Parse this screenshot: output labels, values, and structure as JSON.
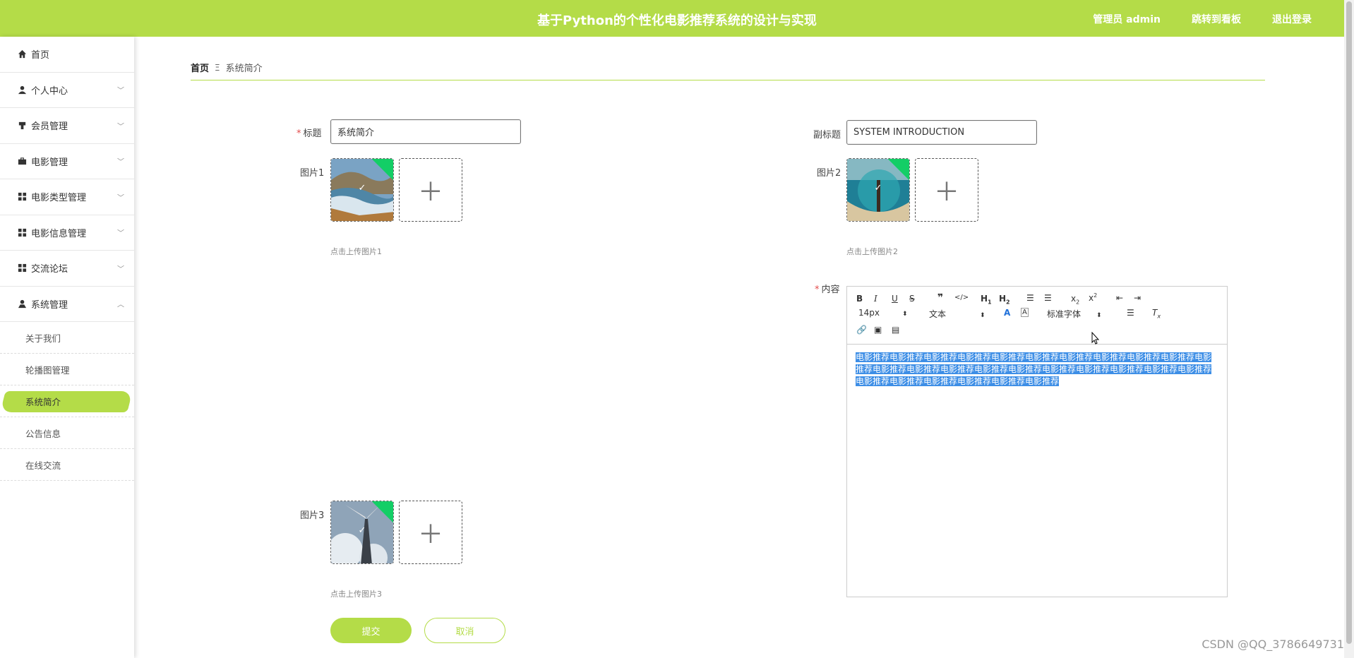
{
  "header": {
    "title": "基于Python的个性化电影推荐系统的设计与实现",
    "admin": "管理员 admin",
    "jump": "跳转到看板",
    "logout": "退出登录"
  },
  "sidebar": {
    "items": [
      {
        "label": "首页",
        "icon": "home-icon"
      },
      {
        "label": "个人中心",
        "icon": "user-icon"
      },
      {
        "label": "会员管理",
        "icon": "members-icon"
      },
      {
        "label": "电影管理",
        "icon": "briefcase-icon"
      },
      {
        "label": "电影类型管理",
        "icon": "grid-icon"
      },
      {
        "label": "电影信息管理",
        "icon": "grid-icon"
      },
      {
        "label": "交流论坛",
        "icon": "grid-icon"
      },
      {
        "label": "系统管理",
        "icon": "system-icon"
      }
    ],
    "sub_items": [
      "关于我们",
      "轮播图管理",
      "系统简介",
      "公告信息",
      "在线交流"
    ],
    "active_sub": "系统简介"
  },
  "breadcrumb": {
    "home": "首页",
    "separator": "Ξ",
    "current": "系统简介"
  },
  "form": {
    "title_label": "标题",
    "title_value": "系统简介",
    "subtitle_label": "副标题",
    "subtitle_value": "SYSTEM INTRODUCTION",
    "pic1_label": "图片1",
    "pic1_hint": "点击上传图片1",
    "pic2_label": "图片2",
    "pic2_hint": "点击上传图片2",
    "pic3_label": "图片3",
    "pic3_hint": "点击上传图片3",
    "content_label": "内容",
    "font_size": "14px",
    "text_type": "文本",
    "font_family": "标准字体",
    "content": "电影推荐电影推荐电影推荐电影推荐电影推荐电影推荐电影推荐电影推荐电影推荐电影推荐电影推荐电影推荐电影推荐电影推荐电影推荐电影推荐电影推荐电影推荐电影推荐电影推荐电影推荐电影推荐电影推荐电影推荐电影推荐电影推荐电影推荐"
  },
  "buttons": {
    "submit": "提交",
    "cancel": "取消"
  },
  "watermark": "CSDN @QQ_3786649731",
  "colors": {
    "accent": "#b4dc48",
    "success": "#13ce66",
    "selection": "#3d8ee6"
  }
}
